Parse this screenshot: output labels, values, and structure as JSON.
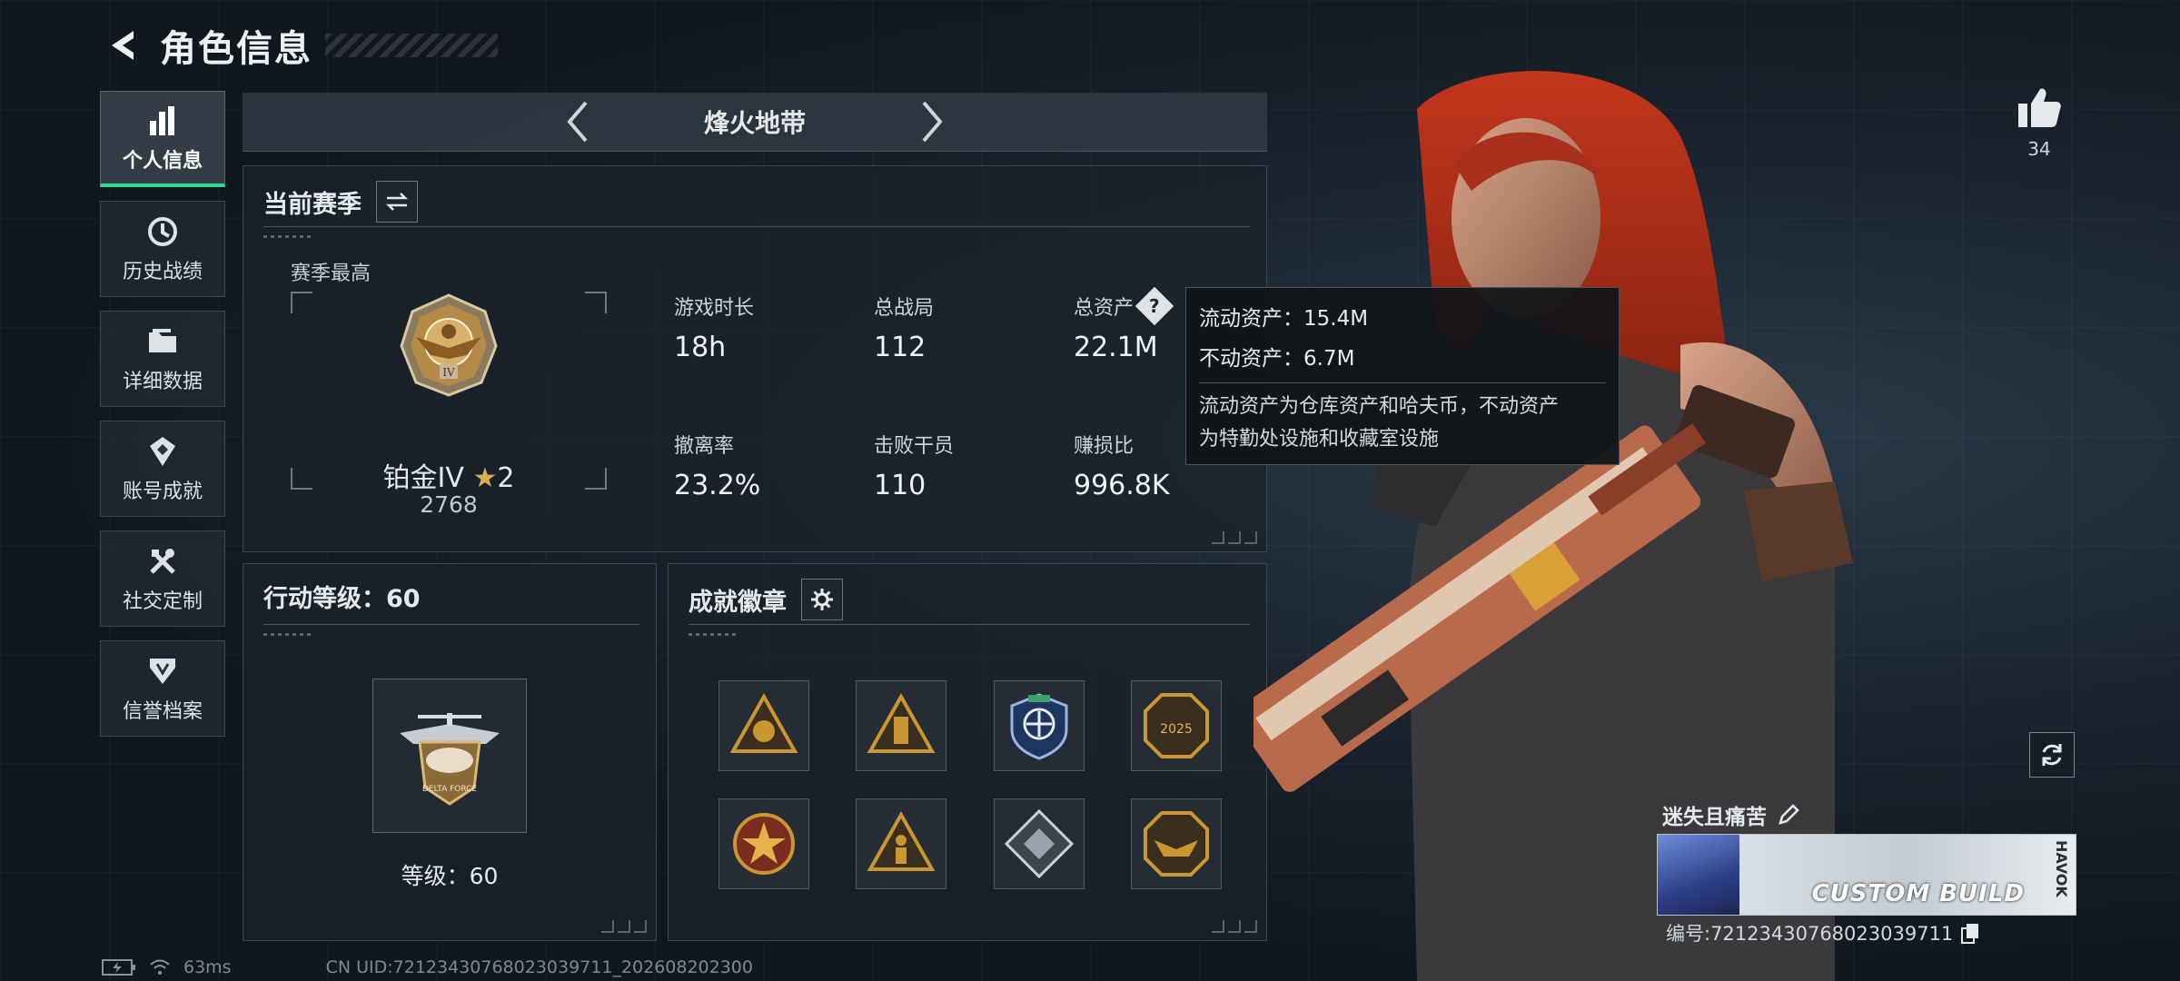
{
  "header": {
    "title": "角色信息"
  },
  "nav": [
    {
      "label": "个人信息",
      "icon": "bar-chart-icon",
      "active": true
    },
    {
      "label": "历史战绩",
      "icon": "history-icon"
    },
    {
      "label": "详细数据",
      "icon": "folder-icon"
    },
    {
      "label": "账号成就",
      "icon": "achievement-icon"
    },
    {
      "label": "社交定制",
      "icon": "tools-icon"
    },
    {
      "label": "信誉档案",
      "icon": "credit-icon"
    }
  ],
  "mode": {
    "label": "烽火地带"
  },
  "season": {
    "title": "当前赛季",
    "best_label": "赛季最高",
    "rank_name": "铂金IV",
    "rank_stars": "2",
    "rank_score": "2768",
    "stats": [
      {
        "label": "游戏时长",
        "value": "18h"
      },
      {
        "label": "总战局",
        "value": "112"
      },
      {
        "label": "总资产",
        "value": "22.1M",
        "help": "?"
      },
      {
        "label": "撤离率",
        "value": "23.2%"
      },
      {
        "label": "击败干员",
        "value": "110"
      },
      {
        "label": "赚损比",
        "value": "996.8K"
      }
    ]
  },
  "tooltip": {
    "liquid": "流动资产：15.4M",
    "fixed": "不动资产：6.7M",
    "note_1": "流动资产为仓库资产和哈夫币，不动资产",
    "note_2": "为特勤处设施和收藏室设施"
  },
  "action_level": {
    "title": "行动等级：60",
    "level_text": "等级：60"
  },
  "badges": {
    "title": "成就徽章",
    "items": [
      {
        "icon": "triangle-fish-badge-icon",
        "color": "#c9962f"
      },
      {
        "icon": "triangle-tower-badge-icon",
        "color": "#c9962f"
      },
      {
        "icon": "shield-plane-badge-icon",
        "color": "#3a6ab0"
      },
      {
        "icon": "octagon-2025-badge-icon",
        "color": "#c9962f"
      },
      {
        "icon": "star-medal-badge-icon",
        "color": "#b7472e"
      },
      {
        "icon": "triangle-soldier-badge-icon",
        "color": "#c9962f"
      },
      {
        "icon": "diamond-badge-icon",
        "color": "#9aa4ae"
      },
      {
        "icon": "octagon-eagle-badge-icon",
        "color": "#c9962f"
      }
    ]
  },
  "like": {
    "count": "34"
  },
  "player": {
    "name": "迷失且痛苦",
    "card_text": "CUSTOM BUILD",
    "card_side": "HAVOK",
    "id_text": "编号:7212343076802303971​1"
  },
  "footer": {
    "ping": "63ms",
    "uid": "CN UID:7212343076802303971​1_202608202300"
  },
  "colors": {
    "accent": "#2fd98c",
    "gold": "#c9962f"
  }
}
